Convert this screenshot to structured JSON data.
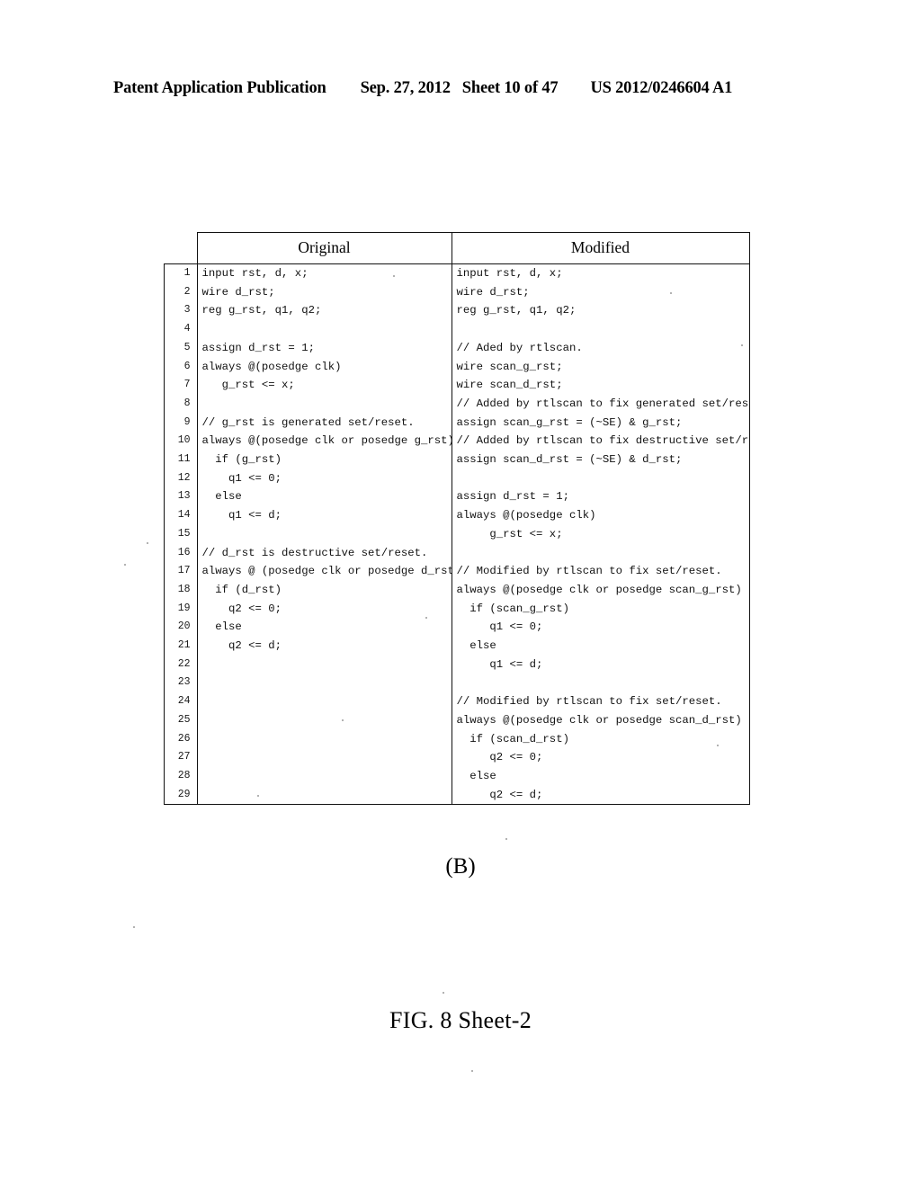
{
  "header": {
    "publication": "Patent Application Publication",
    "date": "Sep. 27, 2012",
    "sheet": "Sheet 10 of 47",
    "document_number": "US 2012/0246604 A1"
  },
  "table": {
    "columns": [
      "Original",
      "Modified"
    ],
    "rows": [
      {
        "n": "1",
        "original": "input rst, d, x;",
        "modified": "input rst, d, x;"
      },
      {
        "n": "2",
        "original": "wire d_rst;",
        "modified": "wire d_rst;"
      },
      {
        "n": "3",
        "original": "reg g_rst, q1, q2;",
        "modified": "reg g_rst, q1, q2;"
      },
      {
        "n": "4",
        "original": "",
        "modified": ""
      },
      {
        "n": "5",
        "original": "assign d_rst = 1;",
        "modified": "// Aded by rtlscan."
      },
      {
        "n": "6",
        "original": "always @(posedge clk)",
        "modified": "wire scan_g_rst;"
      },
      {
        "n": "7",
        "original": "   g_rst <= x;",
        "modified": "wire scan_d_rst;"
      },
      {
        "n": "8",
        "original": "",
        "modified": "// Added by rtlscan to fix generated set/reset."
      },
      {
        "n": "9",
        "original": "// g_rst is generated set/reset.",
        "modified": "assign scan_g_rst = (~SE) & g_rst;"
      },
      {
        "n": "10",
        "original": "always @(posedge clk or posedge g_rst)",
        "modified": "// Added by rtlscan to fix destructive set/reset."
      },
      {
        "n": "11",
        "original": "  if (g_rst)",
        "modified": "assign scan_d_rst = (~SE) & d_rst;"
      },
      {
        "n": "12",
        "original": "    q1 <= 0;",
        "modified": ""
      },
      {
        "n": "13",
        "original": "  else",
        "modified": "assign d_rst = 1;"
      },
      {
        "n": "14",
        "original": "    q1 <= d;",
        "modified": "always @(posedge clk)"
      },
      {
        "n": "15",
        "original": "",
        "modified": "     g_rst <= x;"
      },
      {
        "n": "16",
        "original": "// d_rst is destructive set/reset.",
        "modified": ""
      },
      {
        "n": "17",
        "original": "always @ (posedge clk or posedge d_rst)",
        "modified": "// Modified by rtlscan to fix set/reset."
      },
      {
        "n": "18",
        "original": "  if (d_rst)",
        "modified": "always @(posedge clk or posedge scan_g_rst)"
      },
      {
        "n": "19",
        "original": "    q2 <= 0;",
        "modified": "  if (scan_g_rst)"
      },
      {
        "n": "20",
        "original": "  else",
        "modified": "     q1 <= 0;"
      },
      {
        "n": "21",
        "original": "    q2 <= d;",
        "modified": "  else"
      },
      {
        "n": "22",
        "original": "",
        "modified": "     q1 <= d;"
      },
      {
        "n": "23",
        "original": "",
        "modified": ""
      },
      {
        "n": "24",
        "original": "",
        "modified": "// Modified by rtlscan to fix set/reset."
      },
      {
        "n": "25",
        "original": "",
        "modified": "always @(posedge clk or posedge scan_d_rst)"
      },
      {
        "n": "26",
        "original": "",
        "modified": "  if (scan_d_rst)"
      },
      {
        "n": "27",
        "original": "",
        "modified": "     q2 <= 0;"
      },
      {
        "n": "28",
        "original": "",
        "modified": "  else"
      },
      {
        "n": "29",
        "original": "",
        "modified": "     q2 <= d;"
      }
    ]
  },
  "sub_caption": "(B)",
  "figure_caption": "FIG. 8 Sheet-2"
}
